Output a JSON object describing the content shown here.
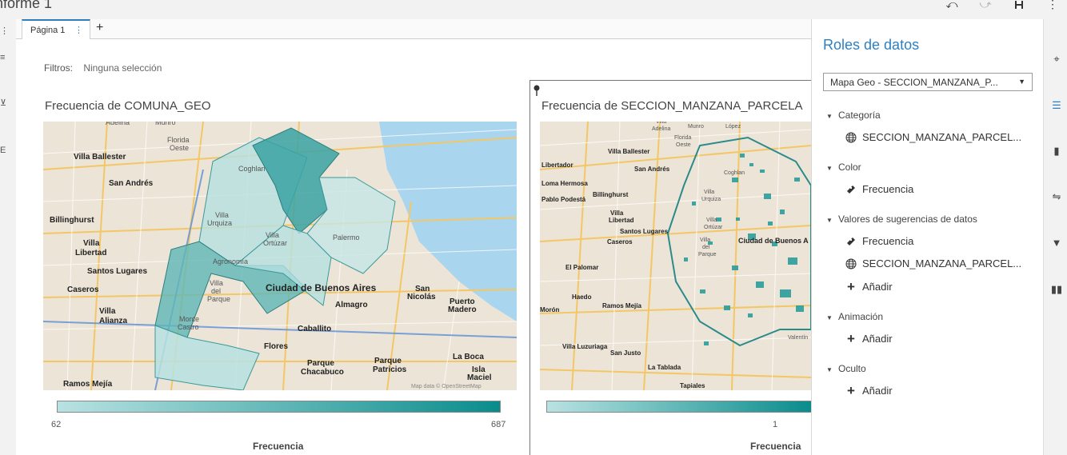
{
  "app": {
    "report_title": "nforme 1"
  },
  "top_icons": [
    "undo-icon",
    "redo-icon",
    "save-icon",
    "more-icon"
  ],
  "tabs": {
    "page_label": "Página 1",
    "kebab": "⋮",
    "add": "+"
  },
  "filters": {
    "label": "Filtros:",
    "value": "Ninguna selección"
  },
  "viz1": {
    "title": "Frecuencia de COMUNA_GEO",
    "legend": {
      "min": "62",
      "max": "687",
      "label": "Frecuencia"
    },
    "map_places": [
      "Adelina",
      "Munro",
      "Florida",
      "Oeste",
      "Villa Ballester",
      "San Andrés",
      "Billinghurst",
      "Villa",
      "Libertad",
      "Santos Lugares",
      "Caseros",
      "Villa",
      "Alianza",
      "Ramos Mejía",
      "Villa",
      "Urquiza",
      "Coghlan",
      "Palermo",
      "Agronomía",
      "Villa",
      "del",
      "Parque",
      "Ciudad de Buenos Aires",
      "Almagro",
      "San",
      "Nicolás",
      "Puerto",
      "Madero",
      "Caballito",
      "Flores",
      "Parque",
      "Chacabuco",
      "Parque",
      "Patricios",
      "La Boca",
      "Isla",
      "Maciel",
      "Villa",
      "Ortúzar",
      "Monte",
      "Castro"
    ],
    "attribution": "Map data © OpenStreetMap"
  },
  "viz2": {
    "title": "Frecuencia de SECCION_MANZANA_PARCELA",
    "legend": {
      "tick": "1",
      "label": "Frecuencia"
    },
    "map_places": [
      "Villa",
      "Adelina",
      "Munro",
      "López",
      "Florida",
      "Oeste",
      "Villa Ballester",
      "Libertador",
      "San Andrés",
      "Loma Hermosa",
      "Coghlan",
      "Pablo Podestá",
      "Billinghurst",
      "Villa",
      "Libertad",
      "Santos Lugares",
      "Caseros",
      "Villa",
      "Urquiza",
      "Villa",
      "Ortúzar",
      "Ciudad de Buenos A",
      "Villa",
      "del",
      "Parque",
      "El Palomar",
      "Haedo",
      "Ramos Mejía",
      "Morón",
      "Villa Luzuriaga",
      "San Justo",
      "La Tablada",
      "Tapiales",
      "Valentín"
    ]
  },
  "roles_panel": {
    "title": "Roles de datos",
    "select_value": "Mapa Geo - SECCION_MANZANA_P...",
    "sections": [
      {
        "label": "Categoría",
        "items": [
          {
            "icon": "geo-icon",
            "label": "SECCION_MANZANA_PARCEL..."
          }
        ]
      },
      {
        "label": "Color",
        "items": [
          {
            "icon": "measure-icon",
            "label": "Frecuencia"
          }
        ]
      },
      {
        "label": "Valores de sugerencias de datos",
        "items": [
          {
            "icon": "measure-icon",
            "label": "Frecuencia"
          },
          {
            "icon": "geo-icon",
            "label": "SECCION_MANZANA_PARCEL..."
          },
          {
            "icon": "add-icon",
            "label": "Añadir"
          }
        ]
      },
      {
        "label": "Animación",
        "items": [
          {
            "icon": "add-icon",
            "label": "Añadir"
          }
        ]
      },
      {
        "label": "Oculto",
        "items": [
          {
            "icon": "add-icon",
            "label": "Añadir"
          }
        ]
      }
    ]
  },
  "right_rail_icons": [
    "palette-icon",
    "data-roles-icon",
    "actions-icon",
    "rules-icon",
    "filter-icon",
    "ranks-icon"
  ],
  "colors": {
    "accent": "#2f7fbf",
    "teal_low": "#b9e2e2",
    "teal_high": "#0a8c8c"
  }
}
